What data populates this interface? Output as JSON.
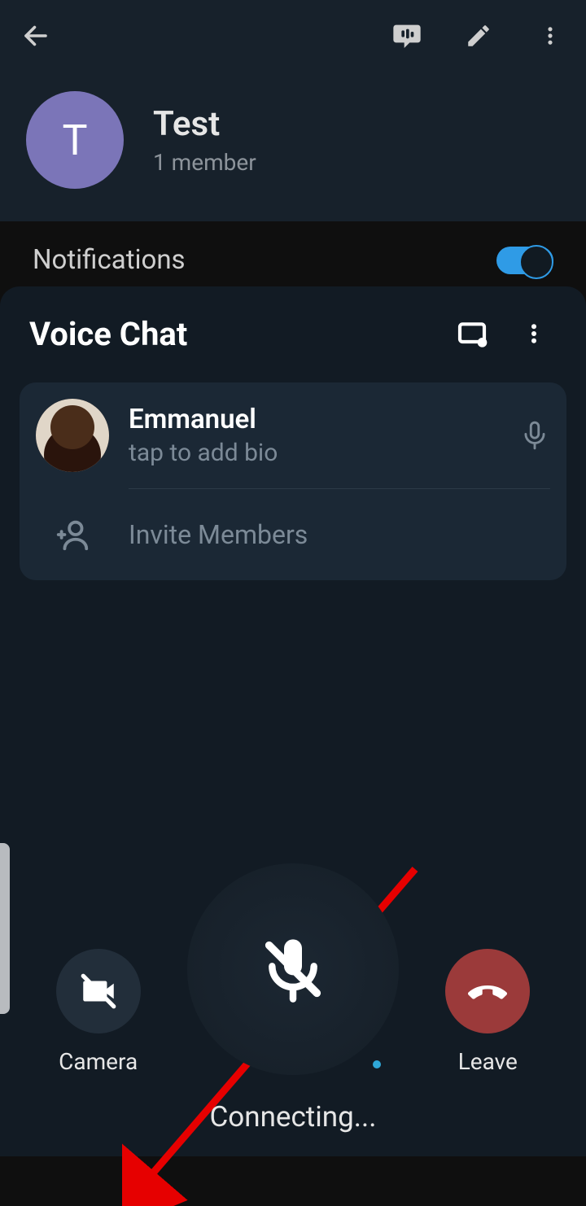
{
  "topbar": {},
  "profile": {
    "initial": "T",
    "title": "Test",
    "subtitle": "1 member"
  },
  "notifications": {
    "label": "Notifications"
  },
  "voice_chat": {
    "title": "Voice Chat",
    "member": {
      "name": "Emmanuel",
      "subtext": "tap to add bio"
    },
    "invite_label": "Invite Members"
  },
  "controls": {
    "camera_label": "Camera",
    "leave_label": "Leave"
  },
  "status": "Connecting..."
}
